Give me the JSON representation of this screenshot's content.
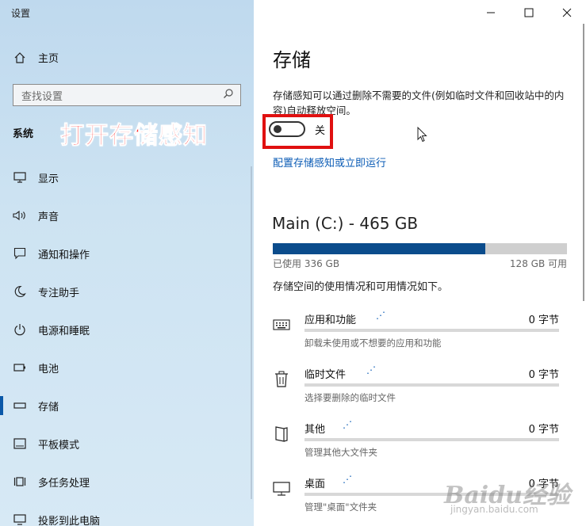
{
  "app": {
    "title": "设置"
  },
  "window_controls": {
    "minimize": "—",
    "maximize": "☐",
    "close": "✕"
  },
  "sidebar": {
    "home_label": "主页",
    "search_placeholder": "查找设置",
    "section_label": "系统",
    "items": [
      {
        "label": "显示",
        "icon": "display-icon"
      },
      {
        "label": "声音",
        "icon": "speaker-icon"
      },
      {
        "label": "通知和操作",
        "icon": "notification-icon"
      },
      {
        "label": "专注助手",
        "icon": "moon-icon"
      },
      {
        "label": "电源和睡眠",
        "icon": "power-icon"
      },
      {
        "label": "电池",
        "icon": "battery-icon"
      },
      {
        "label": "存储",
        "icon": "storage-icon",
        "selected": true
      },
      {
        "label": "平板模式",
        "icon": "tablet-icon"
      },
      {
        "label": "多任务处理",
        "icon": "multitask-icon"
      },
      {
        "label": "投影到此电脑",
        "icon": "project-icon"
      }
    ]
  },
  "annotation": {
    "text": "打开存储感知",
    "color": "#ff1a1a"
  },
  "main": {
    "title": "存储",
    "description": "存储感知可以通过删除不需要的文件(例如临时文件和回收站中的内容)自动释放空间。",
    "toggle": {
      "state_label": "关",
      "on": false
    },
    "link": "配置存储感知或立即运行",
    "drive": {
      "title": "Main (C:) - 465 GB",
      "used_label": "已使用 336 GB",
      "free_label": "128 GB 可用",
      "used_fraction": 0.723
    },
    "usage_desc": "存储空间的使用情况和可用情况如下。",
    "categories": [
      {
        "name": "应用和功能",
        "size": "0 字节",
        "sub": "卸载未使用或不想要的应用和功能",
        "icon": "keyboard-icon"
      },
      {
        "name": "临时文件",
        "size": "0 字节",
        "sub": "选择要删除的临时文件",
        "icon": "trash-icon"
      },
      {
        "name": "其他",
        "size": "0 字节",
        "sub": "管理其他大文件夹",
        "icon": "folder-icon"
      },
      {
        "name": "桌面",
        "size": "0 字节",
        "sub": "管理\"桌面\"文件夹",
        "icon": "monitor-icon"
      }
    ]
  },
  "watermark": {
    "main": "Baidu经验",
    "sub": "jingyan.baidu.com"
  },
  "colors": {
    "accent": "#0a5bb5",
    "drive_bar": "#0b4c8c",
    "highlight": "#e01010"
  }
}
